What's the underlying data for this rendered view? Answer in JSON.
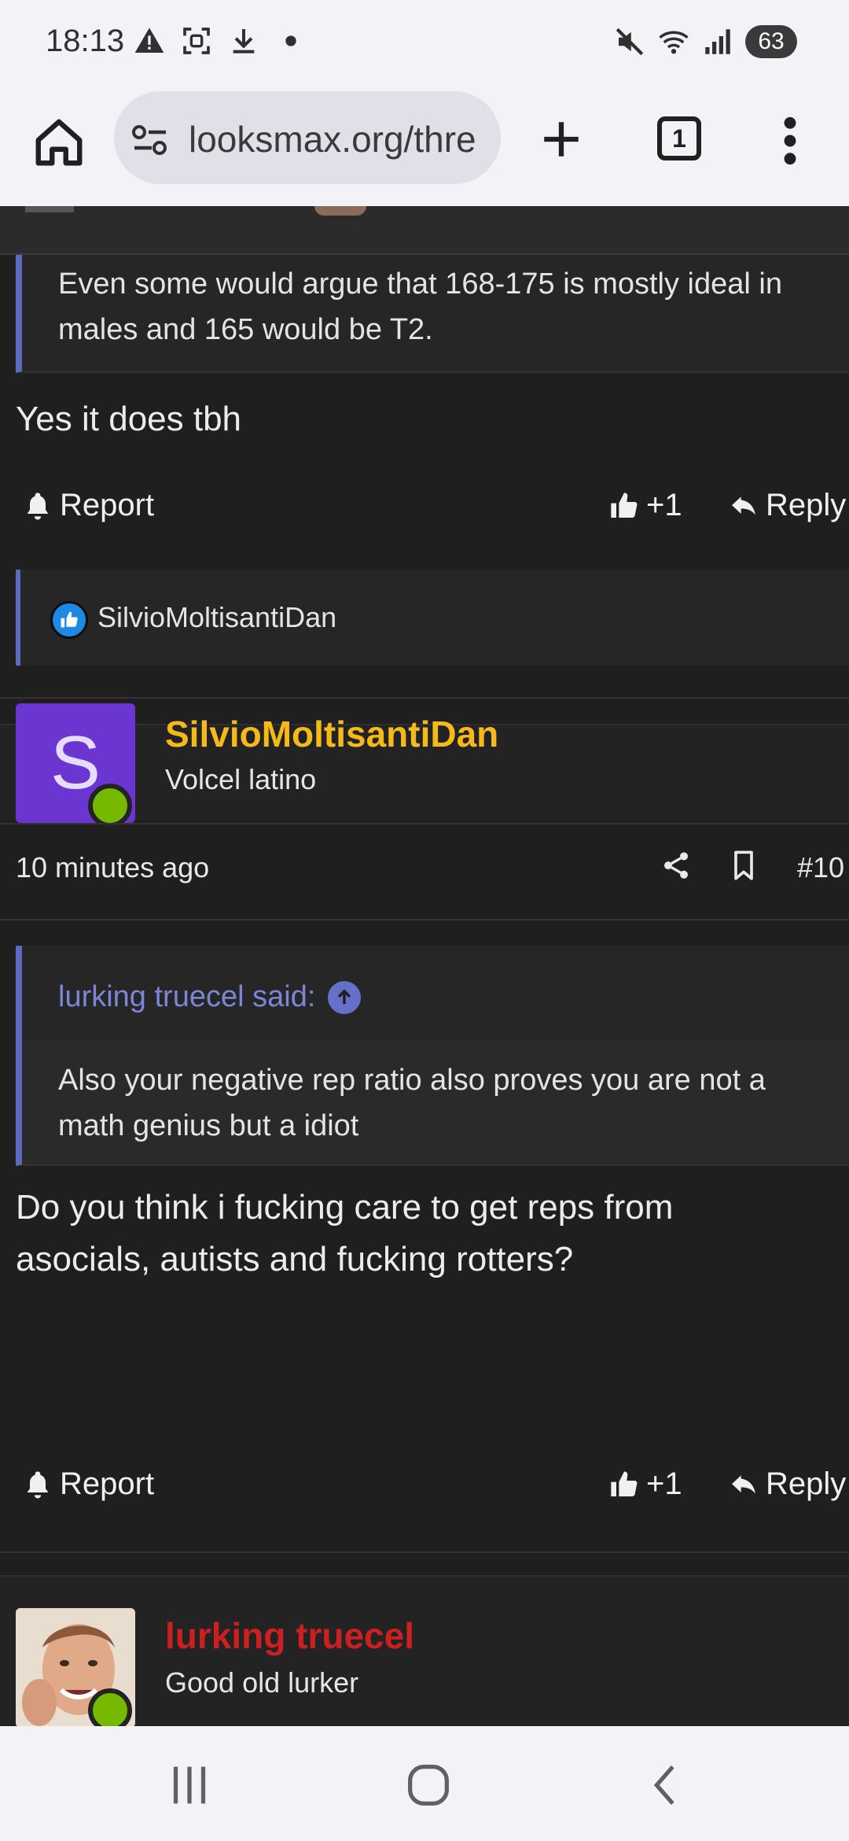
{
  "status_bar": {
    "time": "18:13",
    "battery": "63",
    "left_icons": [
      "warning-icon",
      "screenshot-icon",
      "download-icon",
      "dot-icon"
    ],
    "right_icons": [
      "mute-icon",
      "wifi-icon",
      "signal-icon"
    ]
  },
  "browser": {
    "url": "looksmax.org/thre",
    "tab_count": "1"
  },
  "post1": {
    "quote_text": "Even some would argue that 168-175 is mostly ideal in males and 165 would be T2.",
    "message": "Yes it does tbh",
    "report_label": "Report",
    "like_count": "+1",
    "reply_label": "Reply",
    "reaction_user": "SilvioMoltisantiDan"
  },
  "post2": {
    "avatar_letter": "S",
    "username": "SilvioMoltisantiDan",
    "username_color": "#f5b91a",
    "user_title": "Volcel latino",
    "time": "10 minutes ago",
    "post_number": "#10",
    "quote_author": "lurking truecel said:",
    "quote_text": "Also your negative rep ratio also proves you are not a math genius but a idiot",
    "message": "Do you think i fucking care to get reps from asocials, autists and fucking rotters?",
    "report_label": "Report",
    "like_count": "+1",
    "reply_label": "Reply"
  },
  "post3": {
    "username": "lurking truecel",
    "username_color": "#cc1f1f",
    "user_title": "Good old lurker"
  },
  "colors": {
    "accent_quote_bar": "#5c6bc0",
    "online_dot": "#76b900",
    "avatar_purple": "#6a35d0"
  }
}
